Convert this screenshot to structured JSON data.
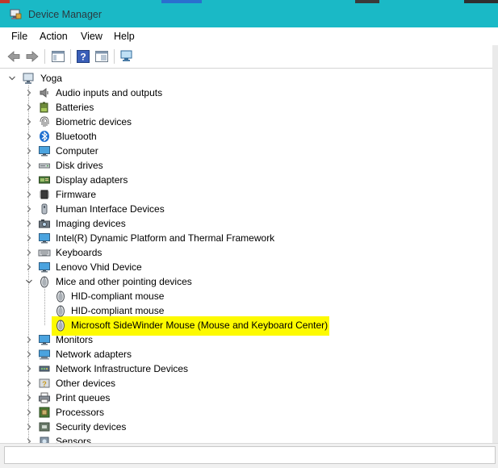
{
  "window": {
    "title": "Device Manager"
  },
  "menu": [
    {
      "label": "File"
    },
    {
      "label": "Action"
    },
    {
      "label": "View"
    },
    {
      "label": "Help"
    }
  ],
  "toolbar": [
    {
      "icon": "back-arrow-icon"
    },
    {
      "icon": "forward-arrow-icon"
    },
    {
      "icon": "show-hide-console-tree-icon"
    },
    {
      "icon": "help-icon"
    },
    {
      "icon": "properties-icon"
    },
    {
      "icon": "scan-hardware-icon"
    }
  ],
  "tree": {
    "root": {
      "label": "Yoga",
      "icon": "computer-icon",
      "expanded": true
    },
    "items": [
      {
        "label": "Audio inputs and outputs",
        "icon": "speaker-icon",
        "level": 1,
        "expanded": false
      },
      {
        "label": "Batteries",
        "icon": "battery-icon",
        "level": 1,
        "expanded": false
      },
      {
        "label": "Biometric devices",
        "icon": "fingerprint-icon",
        "level": 1,
        "expanded": false
      },
      {
        "label": "Bluetooth",
        "icon": "bluetooth-icon",
        "level": 1,
        "expanded": false
      },
      {
        "label": "Computer",
        "icon": "monitor-icon",
        "level": 1,
        "expanded": false
      },
      {
        "label": "Disk drives",
        "icon": "disk-drive-icon",
        "level": 1,
        "expanded": false
      },
      {
        "label": "Display adapters",
        "icon": "display-adapter-icon",
        "level": 1,
        "expanded": false
      },
      {
        "label": "Firmware",
        "icon": "chip-icon",
        "level": 1,
        "expanded": false
      },
      {
        "label": "Human Interface Devices",
        "icon": "hid-icon",
        "level": 1,
        "expanded": false
      },
      {
        "label": "Imaging devices",
        "icon": "camera-icon",
        "level": 1,
        "expanded": false
      },
      {
        "label": "Intel(R) Dynamic Platform and Thermal Framework",
        "icon": "monitor-icon",
        "level": 1,
        "expanded": false
      },
      {
        "label": "Keyboards",
        "icon": "keyboard-icon",
        "level": 1,
        "expanded": false
      },
      {
        "label": "Lenovo Vhid Device",
        "icon": "monitor-icon",
        "level": 1,
        "expanded": false
      },
      {
        "label": "Mice and other pointing devices",
        "icon": "mouse-icon",
        "level": 1,
        "expanded": true
      },
      {
        "label": "HID-compliant mouse",
        "icon": "mouse-icon",
        "level": 2
      },
      {
        "label": "HID-compliant mouse",
        "icon": "mouse-icon",
        "level": 2
      },
      {
        "label": "Microsoft SideWinder Mouse (Mouse and Keyboard Center)",
        "icon": "mouse-icon",
        "level": 2,
        "highlighted": true
      },
      {
        "label": "Monitors",
        "icon": "monitor-icon",
        "level": 1,
        "expanded": false
      },
      {
        "label": "Network adapters",
        "icon": "network-adapter-icon",
        "level": 1,
        "expanded": false
      },
      {
        "label": "Network Infrastructure Devices",
        "icon": "network-infrastructure-icon",
        "level": 1,
        "expanded": false
      },
      {
        "label": "Other devices",
        "icon": "unknown-device-icon",
        "level": 1,
        "expanded": false
      },
      {
        "label": "Print queues",
        "icon": "printer-icon",
        "level": 1,
        "expanded": false
      },
      {
        "label": "Processors",
        "icon": "processor-icon",
        "level": 1,
        "expanded": false
      },
      {
        "label": "Security devices",
        "icon": "security-icon",
        "level": 1,
        "expanded": false
      },
      {
        "label": "Sensors",
        "icon": "sensor-icon",
        "level": 1,
        "expanded": false
      }
    ]
  },
  "colors": {
    "titlebar": "#1ab9c6",
    "highlight": "#fdfa00",
    "tree_line": "#a0a0a0"
  }
}
